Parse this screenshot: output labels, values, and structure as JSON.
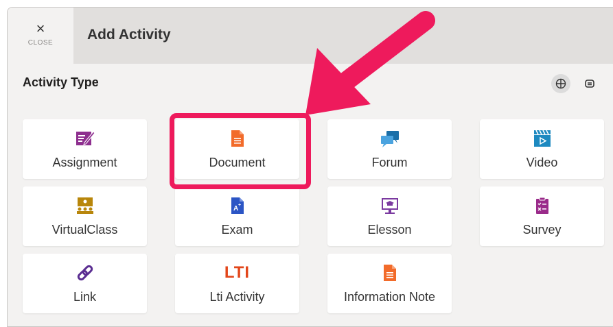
{
  "header": {
    "close_symbol": "×",
    "close_label": "CLOSE",
    "title": "Add Activity"
  },
  "section": {
    "title": "Activity Type"
  },
  "view_toggle": {
    "grid": "grid-view-icon",
    "list": "list-view-icon"
  },
  "tiles": [
    {
      "label": "Assignment",
      "icon": "assignment-icon",
      "color": "#8e2f8f"
    },
    {
      "label": "Document",
      "icon": "document-icon",
      "color": "#f26b2a"
    },
    {
      "label": "Forum",
      "icon": "forum-icon",
      "color": "#1b6fa8"
    },
    {
      "label": "Video",
      "icon": "video-icon",
      "color": "#1d89c0"
    },
    {
      "label": "VirtualClass",
      "icon": "virtual-class-icon",
      "color": "#b8860b"
    },
    {
      "label": "Exam",
      "icon": "exam-icon",
      "color": "#2b55c5"
    },
    {
      "label": "Elesson",
      "icon": "elesson-icon",
      "color": "#7b3aa0"
    },
    {
      "label": "Survey",
      "icon": "survey-icon",
      "color": "#9a2b8a"
    },
    {
      "label": "Link",
      "icon": "link-icon",
      "color": "#5a2d91"
    },
    {
      "label": "Lti Activity",
      "icon": "lti-icon",
      "icon_text": "LTI",
      "color": "#e2461a"
    },
    {
      "label": "Information Note",
      "icon": "information-note-icon",
      "color": "#f26b2a"
    }
  ],
  "annotation": {
    "highlight_color": "#ee1a5c",
    "target": "Document"
  }
}
